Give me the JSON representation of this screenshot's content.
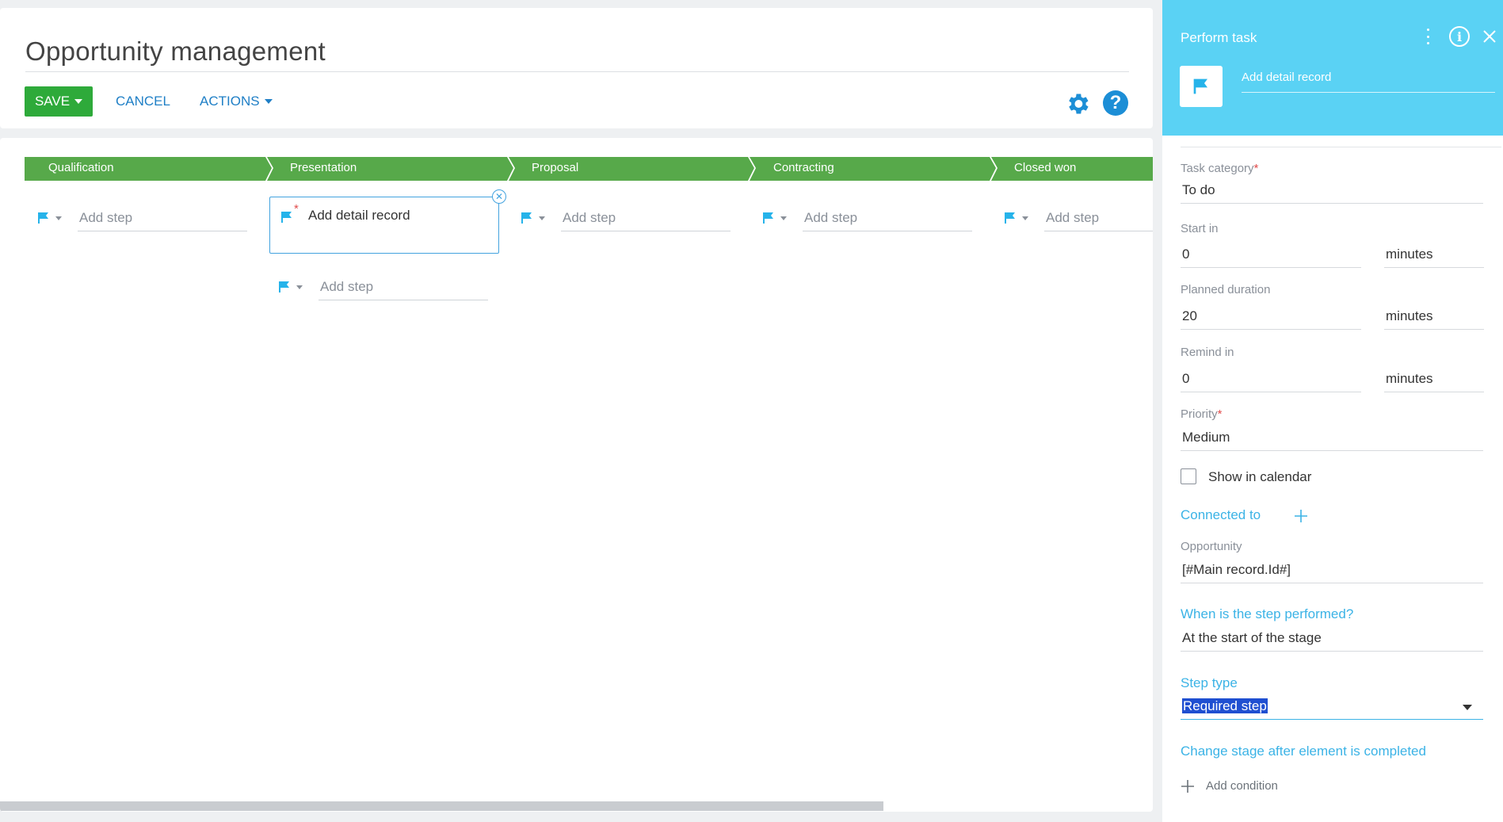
{
  "page": {
    "title": "Opportunity management",
    "toolbar": {
      "save_label": "SAVE",
      "cancel_label": "CANCEL",
      "actions_label": "ACTIONS"
    }
  },
  "stages": [
    {
      "name": "Qualification"
    },
    {
      "name": "Presentation"
    },
    {
      "name": "Proposal"
    },
    {
      "name": "Contracting"
    },
    {
      "name": "Closed won"
    }
  ],
  "steps": {
    "add_step_placeholder": "Add step",
    "active_step_label": "Add detail record"
  },
  "panel": {
    "title": "Perform task",
    "element_name": "Add detail record",
    "task_category": {
      "label": "Task category",
      "value": "To do"
    },
    "start_in": {
      "label": "Start in",
      "value": "0",
      "unit": "minutes"
    },
    "planned_duration": {
      "label": "Planned duration",
      "value": "20",
      "unit": "minutes"
    },
    "remind_in": {
      "label": "Remind in",
      "value": "0",
      "unit": "minutes"
    },
    "priority": {
      "label": "Priority",
      "value": "Medium"
    },
    "show_in_calendar": {
      "label": "Show in calendar",
      "checked": false
    },
    "connected_to": {
      "title": "Connected to"
    },
    "opportunity": {
      "label": "Opportunity",
      "value": "[#Main record.Id#]"
    },
    "when_performed": {
      "title": "When is the step performed?",
      "value": "At the start of the stage"
    },
    "step_type": {
      "title": "Step type",
      "value": "Required step"
    },
    "change_stage": {
      "title": "Change stage after element is completed",
      "add_condition": "Add condition"
    }
  },
  "colors": {
    "stage_green": "#57a94a",
    "panel_header": "#5ad2f4",
    "accent_blue": "#1f7fc6",
    "flag_blue": "#26b3ea",
    "save_green": "#2eaa3a"
  }
}
